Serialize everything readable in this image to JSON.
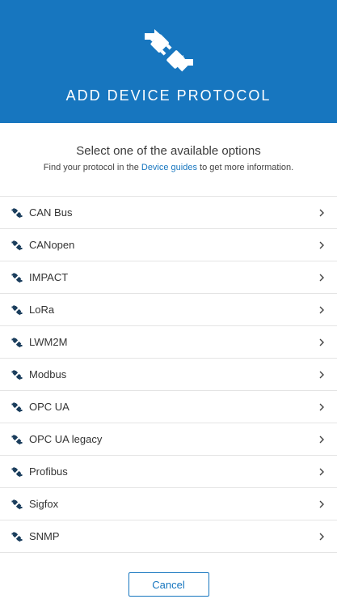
{
  "header": {
    "title": "ADD DEVICE PROTOCOL",
    "icon": "plug-connection-icon",
    "background_color": "#1776bf"
  },
  "intro": {
    "title": "Select one of the available options",
    "sub_before": "Find your protocol in the ",
    "sub_link": "Device guides",
    "sub_after": " to get more information."
  },
  "protocols": [
    {
      "label": "CAN Bus",
      "icon": "plug-icon"
    },
    {
      "label": "CANopen",
      "icon": "plug-icon"
    },
    {
      "label": "IMPACT",
      "icon": "plug-icon"
    },
    {
      "label": "LoRa",
      "icon": "plug-icon"
    },
    {
      "label": "LWM2M",
      "icon": "plug-icon"
    },
    {
      "label": "Modbus",
      "icon": "plug-icon"
    },
    {
      "label": "OPC UA",
      "icon": "plug-icon"
    },
    {
      "label": "OPC UA legacy",
      "icon": "plug-icon"
    },
    {
      "label": "Profibus",
      "icon": "plug-icon"
    },
    {
      "label": "Sigfox",
      "icon": "plug-icon"
    },
    {
      "label": "SNMP",
      "icon": "plug-icon"
    }
  ],
  "footer": {
    "cancel_label": "Cancel"
  },
  "colors": {
    "accent": "#1776bf",
    "text": "#333333",
    "divider": "#e4e4e4",
    "icon": "#1a3d5c"
  }
}
